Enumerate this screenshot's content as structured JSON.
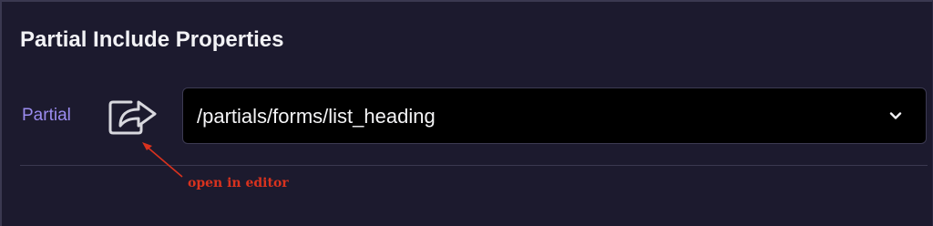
{
  "panel": {
    "title": "Partial Include Properties"
  },
  "field": {
    "label": "Partial",
    "open_icon": "share-forward-icon",
    "select_value": "/partials/forms/list_heading",
    "dropdown_icon": "chevron-down-icon"
  },
  "annotation": {
    "text": "open in editor",
    "color": "#d9321e"
  },
  "colors": {
    "background": "#1c1a2e",
    "label_accent": "#9b8cf0",
    "select_background": "#000000"
  }
}
